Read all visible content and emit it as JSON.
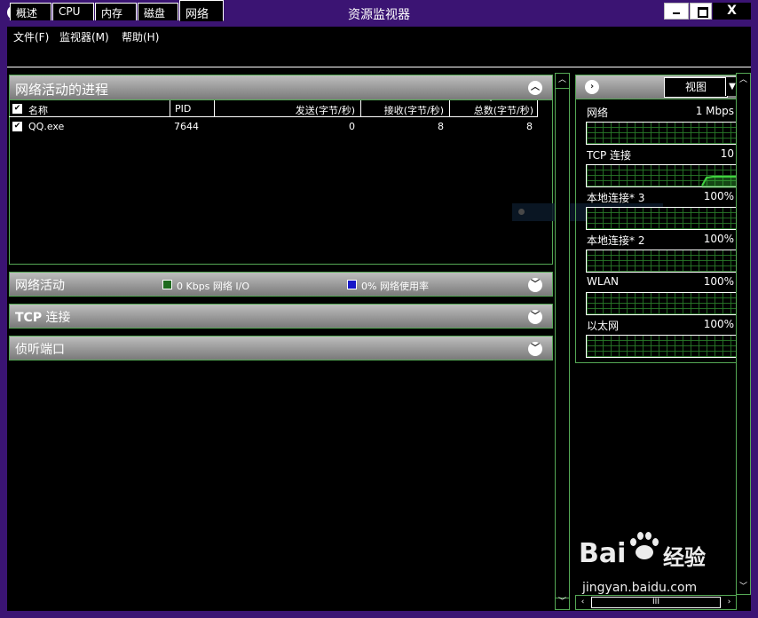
{
  "window": {
    "title": "资源监视器",
    "close_label": "X"
  },
  "menubar": {
    "items": [
      "文件(F)",
      "监视器(M)",
      "帮助(H)"
    ]
  },
  "tabs": {
    "items": [
      "概述",
      "CPU",
      "内存",
      "磁盘",
      "网络"
    ],
    "active_index": 4
  },
  "processes": {
    "title": "网络活动的进程",
    "columns": [
      "名称",
      "PID",
      "发送(字节/秒)",
      "接收(字节/秒)",
      "总数(字节/秒)"
    ],
    "rows": [
      {
        "checked": true,
        "name": "QQ.exe",
        "pid": "7644",
        "send": "0",
        "receive": "8",
        "total": "8"
      }
    ]
  },
  "net_activity": {
    "title": "网络活动",
    "legend": [
      {
        "color": "#1f6b1f",
        "text": "0 Kbps 网络 I/O"
      },
      {
        "color": "#1616c8",
        "text": "0% 网络使用率"
      }
    ]
  },
  "tcp_section": {
    "title_bold": "TCP",
    "title_rest": " 连接"
  },
  "listen_section": {
    "title": "侦听端口"
  },
  "right_panel": {
    "view_label": "视图",
    "graphs": [
      {
        "name": "网络",
        "value": "1 Mbps"
      },
      {
        "name": "TCP 连接",
        "value": "10"
      },
      {
        "name": "本地连接* 3",
        "value": "100%"
      },
      {
        "name": "本地连接* 2",
        "value": "100%"
      },
      {
        "name": "WLAN",
        "value": "100%"
      },
      {
        "name": "以太网",
        "value": "100%"
      }
    ]
  },
  "watermark": {
    "brand_left": "Bai",
    "brand_right": "经验",
    "url": "jingyan.baidu.com"
  },
  "colors": {
    "titlebar": "#3b1473",
    "accent_green": "#55a855"
  }
}
